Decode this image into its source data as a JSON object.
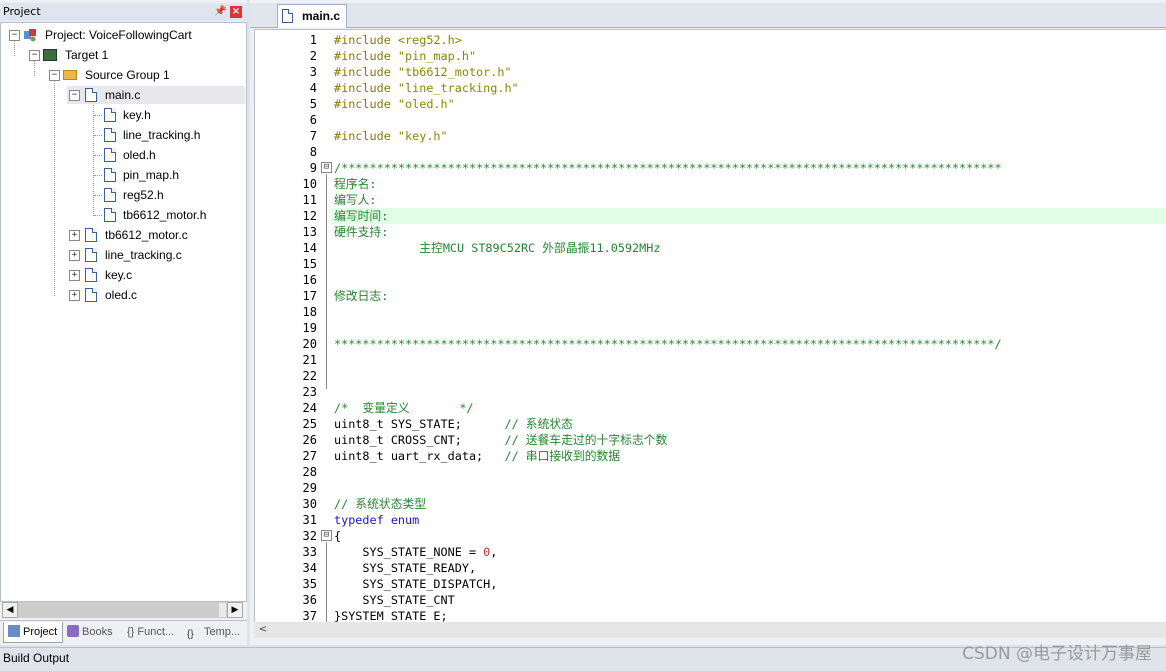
{
  "project_pane": {
    "title": "Project",
    "pin": "ᵖ",
    "close": "×",
    "tree": {
      "project": "Project: VoiceFollowingCart",
      "target": "Target 1",
      "source_group": "Source Group 1",
      "main_file": "main.c",
      "main_includes": [
        "key.h",
        "line_tracking.h",
        "oled.h",
        "pin_map.h",
        "reg52.h",
        "tb6612_motor.h"
      ],
      "other_files": [
        "tb6612_motor.c",
        "line_tracking.c",
        "key.c",
        "oled.c"
      ]
    },
    "bottom_tabs": [
      "Project",
      "Books",
      "{} Funct...",
      "Temp..."
    ]
  },
  "editor": {
    "tab_label": "main.c",
    "line_numbers": [
      "1",
      "2",
      "3",
      "4",
      "5",
      "6",
      "7",
      "8",
      "9",
      "10",
      "11",
      "12",
      "13",
      "14",
      "15",
      "16",
      "17",
      "18",
      "19",
      "20",
      "21",
      "22",
      "23",
      "24",
      "25",
      "26",
      "27",
      "28",
      "29",
      "30",
      "31",
      "32",
      "33",
      "34",
      "35",
      "36",
      "37"
    ],
    "lines": {
      "l1a": "#include ",
      "l1b": "<reg52.h>",
      "l2a": "#include ",
      "l2b": "\"pin_map.h\"",
      "l3a": "#include ",
      "l3b": "\"tb6612_motor.h\"",
      "l4a": "#include ",
      "l4b": "\"line_tracking.h\"",
      "l5a": "#include ",
      "l5b": "\"oled.h\"",
      "l7a": "#include ",
      "l7b": "\"key.h\"",
      "l9": "/*********************************************************************************************",
      "l10": "程序名:",
      "l11": "编写人:",
      "l12": "编写时间:",
      "l13": "硬件支持:",
      "l14": "            主控MCU ST89C52RC 外部晶振11.0592MHz",
      "l17": "修改日志:",
      "l20": "*********************************************************************************************/",
      "l24": "/*  变量定义       */",
      "l25a": "uint8_t SYS_STATE;      ",
      "l25b": "// 系统状态",
      "l26a": "uint8_t CROSS_CNT;      ",
      "l26b": "// 送餐车走过的十字标志个数",
      "l27a": "uint8_t uart_rx_data;   ",
      "l27b": "// 串口接收到的数据",
      "l30": "// 系统状态类型",
      "l31a": "typedef",
      "l31b": " ",
      "l31c": "enum",
      "l32": "{",
      "l33a": "    SYS_STATE_NONE = ",
      "l33b": "0",
      "l33c": ",",
      "l34": "    SYS_STATE_READY,",
      "l35": "    SYS_STATE_DISPATCH,",
      "l36": "    SYS_STATE_CNT",
      "l37": "}SYSTEM_STATE_E;"
    },
    "fold_marks": [
      "⊟",
      "⊟"
    ]
  },
  "build_output": {
    "title": "Build Output"
  },
  "watermark": "CSDN @电子设计万事屋",
  "colors": {
    "comment": "#22862e",
    "keyword": "#1616c8",
    "string": "#888800",
    "preprocessor": "#8a7700",
    "current_line": "#e0ffe6"
  }
}
